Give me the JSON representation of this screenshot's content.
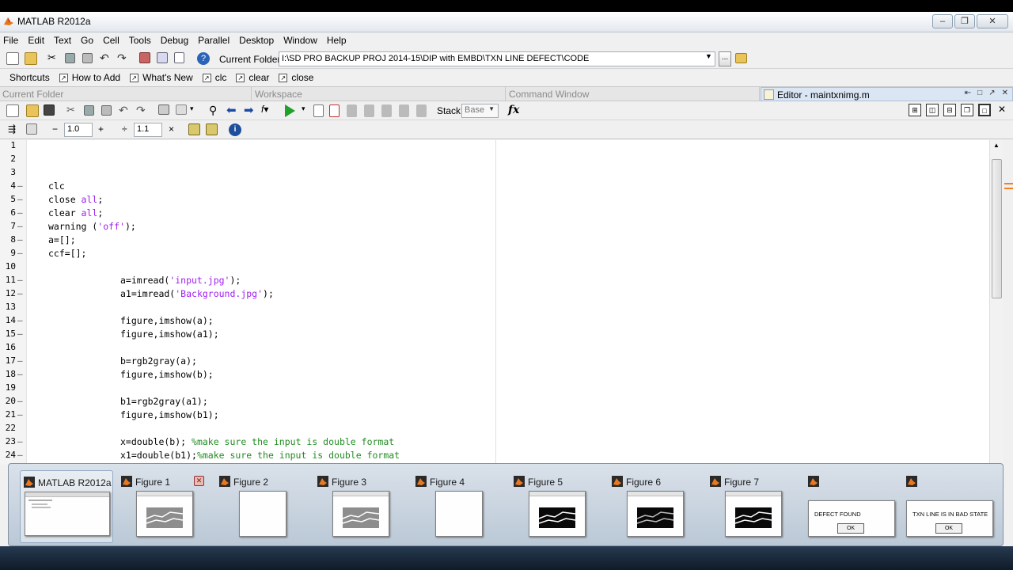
{
  "window": {
    "title": "MATLAB  R2012a"
  },
  "menu": [
    "File",
    "Edit",
    "Text",
    "Go",
    "Cell",
    "Tools",
    "Debug",
    "Parallel",
    "Desktop",
    "Window",
    "Help"
  ],
  "toolbar": {
    "current_folder_label": "Current Folder:",
    "current_folder_value": "I:\\SD PRO BACKUP PROJ 2014-15\\DIP with EMBD\\TXN LINE DEFECT\\CODE",
    "browse_label": "..."
  },
  "shortcuts": {
    "label": "Shortcuts",
    "items": [
      "How to Add",
      "What's New",
      "clc",
      "clear",
      "close"
    ]
  },
  "panels": {
    "current_folder": "Current Folder",
    "workspace": "Workspace",
    "command_window": "Command Window",
    "editor_tab": "Editor - maintxnimg.m"
  },
  "editor_toolbar": {
    "stack_label": "Stack:",
    "stack_value": "Base",
    "fx": "fx"
  },
  "cell_toolbar": {
    "minus": "−",
    "value1": "1.0",
    "plus": "+",
    "divide": "÷",
    "value2": "1.1",
    "times": "×"
  },
  "code_lines": [
    {
      "n": "1",
      "dash": false,
      "indent": 0,
      "parts": []
    },
    {
      "n": "2",
      "dash": false,
      "indent": 0,
      "parts": []
    },
    {
      "n": "3",
      "dash": false,
      "indent": 0,
      "parts": []
    },
    {
      "n": "4",
      "dash": true,
      "indent": 1,
      "parts": [
        {
          "t": "clc",
          "c": ""
        }
      ]
    },
    {
      "n": "5",
      "dash": true,
      "indent": 1,
      "parts": [
        {
          "t": "close ",
          "c": ""
        },
        {
          "t": "all",
          "c": "str"
        },
        {
          "t": ";",
          "c": ""
        }
      ]
    },
    {
      "n": "6",
      "dash": true,
      "indent": 1,
      "parts": [
        {
          "t": "clear ",
          "c": ""
        },
        {
          "t": "all",
          "c": "str"
        },
        {
          "t": ";",
          "c": ""
        }
      ]
    },
    {
      "n": "7",
      "dash": true,
      "indent": 1,
      "parts": [
        {
          "t": "warning (",
          "c": ""
        },
        {
          "t": "'off'",
          "c": "str"
        },
        {
          "t": ");",
          "c": ""
        }
      ]
    },
    {
      "n": "8",
      "dash": true,
      "indent": 1,
      "parts": [
        {
          "t": "a=[];",
          "c": ""
        }
      ]
    },
    {
      "n": "9",
      "dash": true,
      "indent": 1,
      "parts": [
        {
          "t": "ccf=[];",
          "c": ""
        }
      ]
    },
    {
      "n": "10",
      "dash": false,
      "indent": 0,
      "parts": []
    },
    {
      "n": "11",
      "dash": true,
      "indent": 2,
      "parts": [
        {
          "t": "a=imread(",
          "c": ""
        },
        {
          "t": "'input.jpg'",
          "c": "str"
        },
        {
          "t": ");",
          "c": ""
        }
      ]
    },
    {
      "n": "12",
      "dash": true,
      "indent": 2,
      "parts": [
        {
          "t": "a1=imread(",
          "c": ""
        },
        {
          "t": "'Background.jpg'",
          "c": "str"
        },
        {
          "t": ");",
          "c": ""
        }
      ]
    },
    {
      "n": "13",
      "dash": false,
      "indent": 0,
      "parts": []
    },
    {
      "n": "14",
      "dash": true,
      "indent": 2,
      "parts": [
        {
          "t": "figure,imshow(a);",
          "c": ""
        }
      ]
    },
    {
      "n": "15",
      "dash": true,
      "indent": 2,
      "parts": [
        {
          "t": "figure,imshow(a1);",
          "c": ""
        }
      ]
    },
    {
      "n": "16",
      "dash": false,
      "indent": 0,
      "parts": []
    },
    {
      "n": "17",
      "dash": true,
      "indent": 2,
      "parts": [
        {
          "t": "b=rgb2gray(a);",
          "c": ""
        }
      ]
    },
    {
      "n": "18",
      "dash": true,
      "indent": 2,
      "parts": [
        {
          "t": "figure,imshow(b);",
          "c": ""
        }
      ]
    },
    {
      "n": "19",
      "dash": false,
      "indent": 0,
      "parts": []
    },
    {
      "n": "20",
      "dash": true,
      "indent": 2,
      "parts": [
        {
          "t": "b1=rgb2gray(a1);",
          "c": ""
        }
      ]
    },
    {
      "n": "21",
      "dash": true,
      "indent": 2,
      "parts": [
        {
          "t": "figure,imshow(b1);",
          "c": ""
        }
      ]
    },
    {
      "n": "22",
      "dash": false,
      "indent": 0,
      "parts": []
    },
    {
      "n": "23",
      "dash": true,
      "indent": 2,
      "parts": [
        {
          "t": "x=double(b); ",
          "c": ""
        },
        {
          "t": "%make sure the input is double format",
          "c": "cm"
        }
      ]
    },
    {
      "n": "24",
      "dash": true,
      "indent": 2,
      "parts": [
        {
          "t": "x1=double(b1);",
          "c": ""
        },
        {
          "t": "%make sure the input is double format",
          "c": "cm"
        }
      ]
    }
  ],
  "taskbar_previews": [
    {
      "label": "MATLAB  R2012a",
      "kind": "app",
      "active": true
    },
    {
      "label": "Figure 1",
      "kind": "gray",
      "active": false,
      "closable": true
    },
    {
      "label": "Figure 2",
      "kind": "white",
      "active": false
    },
    {
      "label": "Figure 3",
      "kind": "gray",
      "active": false
    },
    {
      "label": "Figure 4",
      "kind": "white",
      "active": false
    },
    {
      "label": "Figure 5",
      "kind": "bw",
      "active": false
    },
    {
      "label": "Figure 6",
      "kind": "black",
      "active": false
    },
    {
      "label": "Figure 7",
      "kind": "bw",
      "active": false
    },
    {
      "label": "",
      "kind": "dialog",
      "dialog_text": "DEFECT FOUND",
      "ok": "OK"
    },
    {
      "label": "",
      "kind": "dialog",
      "dialog_text": "TXN LINE IS IN BAD STATE",
      "ok": "OK"
    }
  ],
  "colors": {
    "string": "#a020f0",
    "comment": "#228b22",
    "active_tab": "#dbe6f4",
    "matlab_orange": "#e8751a"
  }
}
